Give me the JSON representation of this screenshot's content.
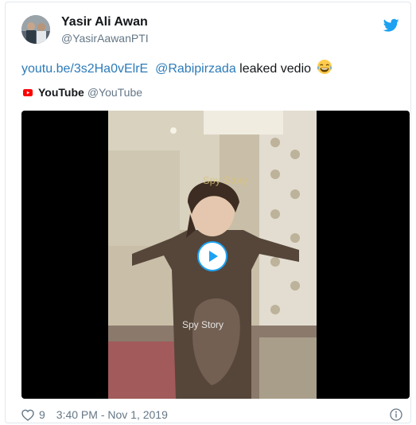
{
  "author": {
    "name": "Yasir Ali Awan",
    "handle": "@YasirAawanPTI"
  },
  "tweet": {
    "link": "youtu.be/3s2Ha0vElrE",
    "mention": "@Rabipirzada",
    "text": "leaked vedio",
    "emoji": "joy-emoji"
  },
  "card": {
    "source_name": "YouTube",
    "source_handle": "@YouTube",
    "watermark_top": "Spy Story",
    "watermark_mid": "Spy Story"
  },
  "footer": {
    "likes": "9",
    "timestamp": "3:40 PM - Nov 1, 2019"
  },
  "icons": {
    "brand_bird": "twitter-bird-icon",
    "source_logo": "youtube-logo-icon",
    "play": "play-icon",
    "like": "heart-icon",
    "info": "info-icon"
  },
  "colors": {
    "link": "#2b7bb9",
    "twitter_blue": "#1da1f2",
    "youtube_red": "#ff0000",
    "muted": "#657786"
  }
}
